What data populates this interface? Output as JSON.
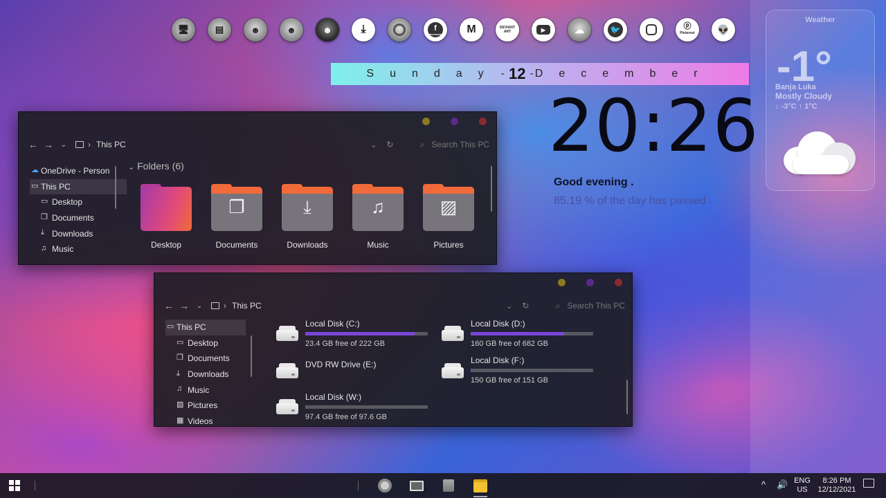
{
  "social_icons": [
    {
      "name": "desktop-app-icon"
    },
    {
      "name": "photo-app-icon"
    },
    {
      "name": "avatar-1-icon"
    },
    {
      "name": "avatar-2-icon"
    },
    {
      "name": "avatar-3-icon"
    },
    {
      "name": "download-icon"
    },
    {
      "name": "chrome-icon"
    },
    {
      "name": "facebook-icon",
      "label": "facebook"
    },
    {
      "name": "gmail-icon"
    },
    {
      "name": "deviantart-icon",
      "label": "DEVIANT ART"
    },
    {
      "name": "youtube-icon"
    },
    {
      "name": "soundcloud-icon"
    },
    {
      "name": "twitter-icon"
    },
    {
      "name": "instagram-icon"
    },
    {
      "name": "pinterest-icon",
      "label": "Pinterest"
    },
    {
      "name": "reddit-icon"
    }
  ],
  "date": {
    "weekday": "Sunday",
    "sep_left": "-",
    "day": "12",
    "sep_right": "-",
    "month": "December"
  },
  "clock": {
    "time": "20:26",
    "greeting": "Good evening .",
    "progress_text": "85.19 % of the day has passed ."
  },
  "weather": {
    "title": "Weather",
    "temp": "-1°",
    "city": "Banja Luka",
    "condition": "Mostly Cloudy",
    "range": "↓ -3°C  ↑ 1°C",
    "icon": "cloud-icon"
  },
  "explorer1": {
    "address": "This PC",
    "search_placeholder": "Search This PC",
    "section_title": "Folders (6)",
    "nav": [
      {
        "label": "OneDrive - Person",
        "icon": "onedrive-icon"
      },
      {
        "label": "This PC",
        "icon": "pc-icon",
        "selected": true
      },
      {
        "label": "Desktop",
        "icon": "desktop-icon"
      },
      {
        "label": "Documents",
        "icon": "documents-icon"
      },
      {
        "label": "Downloads",
        "icon": "downloads-icon"
      },
      {
        "label": "Music",
        "icon": "music-icon"
      }
    ],
    "folders": [
      {
        "label": "Desktop",
        "icon": "desktop-folder-icon"
      },
      {
        "label": "Documents",
        "icon": "documents-folder-icon"
      },
      {
        "label": "Downloads",
        "icon": "downloads-folder-icon"
      },
      {
        "label": "Music",
        "icon": "music-folder-icon"
      },
      {
        "label": "Pictures",
        "icon": "pictures-folder-icon"
      }
    ],
    "window_dots": [
      "#8a7a20",
      "#5a2a8a",
      "#8a2a30"
    ]
  },
  "explorer2": {
    "address": "This PC",
    "search_placeholder": "Search This PC",
    "nav": [
      {
        "label": "This PC",
        "icon": "pc-icon",
        "selected": true
      },
      {
        "label": "Desktop",
        "icon": "desktop-icon"
      },
      {
        "label": "Documents",
        "icon": "documents-icon"
      },
      {
        "label": "Downloads",
        "icon": "downloads-icon"
      },
      {
        "label": "Music",
        "icon": "music-icon"
      },
      {
        "label": "Pictures",
        "icon": "pictures-icon"
      },
      {
        "label": "Videos",
        "icon": "videos-icon"
      }
    ],
    "drives": [
      {
        "name": "Local Disk (C:)",
        "free": "23.4 GB free of 222 GB",
        "used_fraction": 0.895
      },
      {
        "name": "Local Disk (D:)",
        "free": "160 GB free of 682 GB",
        "used_fraction": 0.765
      },
      {
        "name": "DVD RW Drive (E:)"
      },
      {
        "name": "Local Disk (F:)",
        "free": "150 GB free of 151 GB",
        "used_fraction": 0.007
      },
      {
        "name": "Local Disk (W:)",
        "free": "97.4 GB free of 97.6 GB",
        "used_fraction": 0.002
      }
    ],
    "window_dots": [
      "#8a7a20",
      "#5a2a8a",
      "#8a2a30"
    ]
  },
  "taskbar": {
    "apps": [
      "start-button",
      "search-bar-handle",
      "chrome-taskbar-icon",
      "this-pc-taskbar-icon",
      "notepad-taskbar-icon",
      "file-explorer-taskbar-icon"
    ],
    "lang_top": "ENG",
    "lang_bottom": "US",
    "time": "8:26 PM",
    "date": "12/12/2021"
  },
  "colors": {
    "bar_fill": "#7a47d8",
    "bar_bg": "#585860",
    "folder_orange": "#f06a3a",
    "folder_purple": "#b33a9a"
  }
}
